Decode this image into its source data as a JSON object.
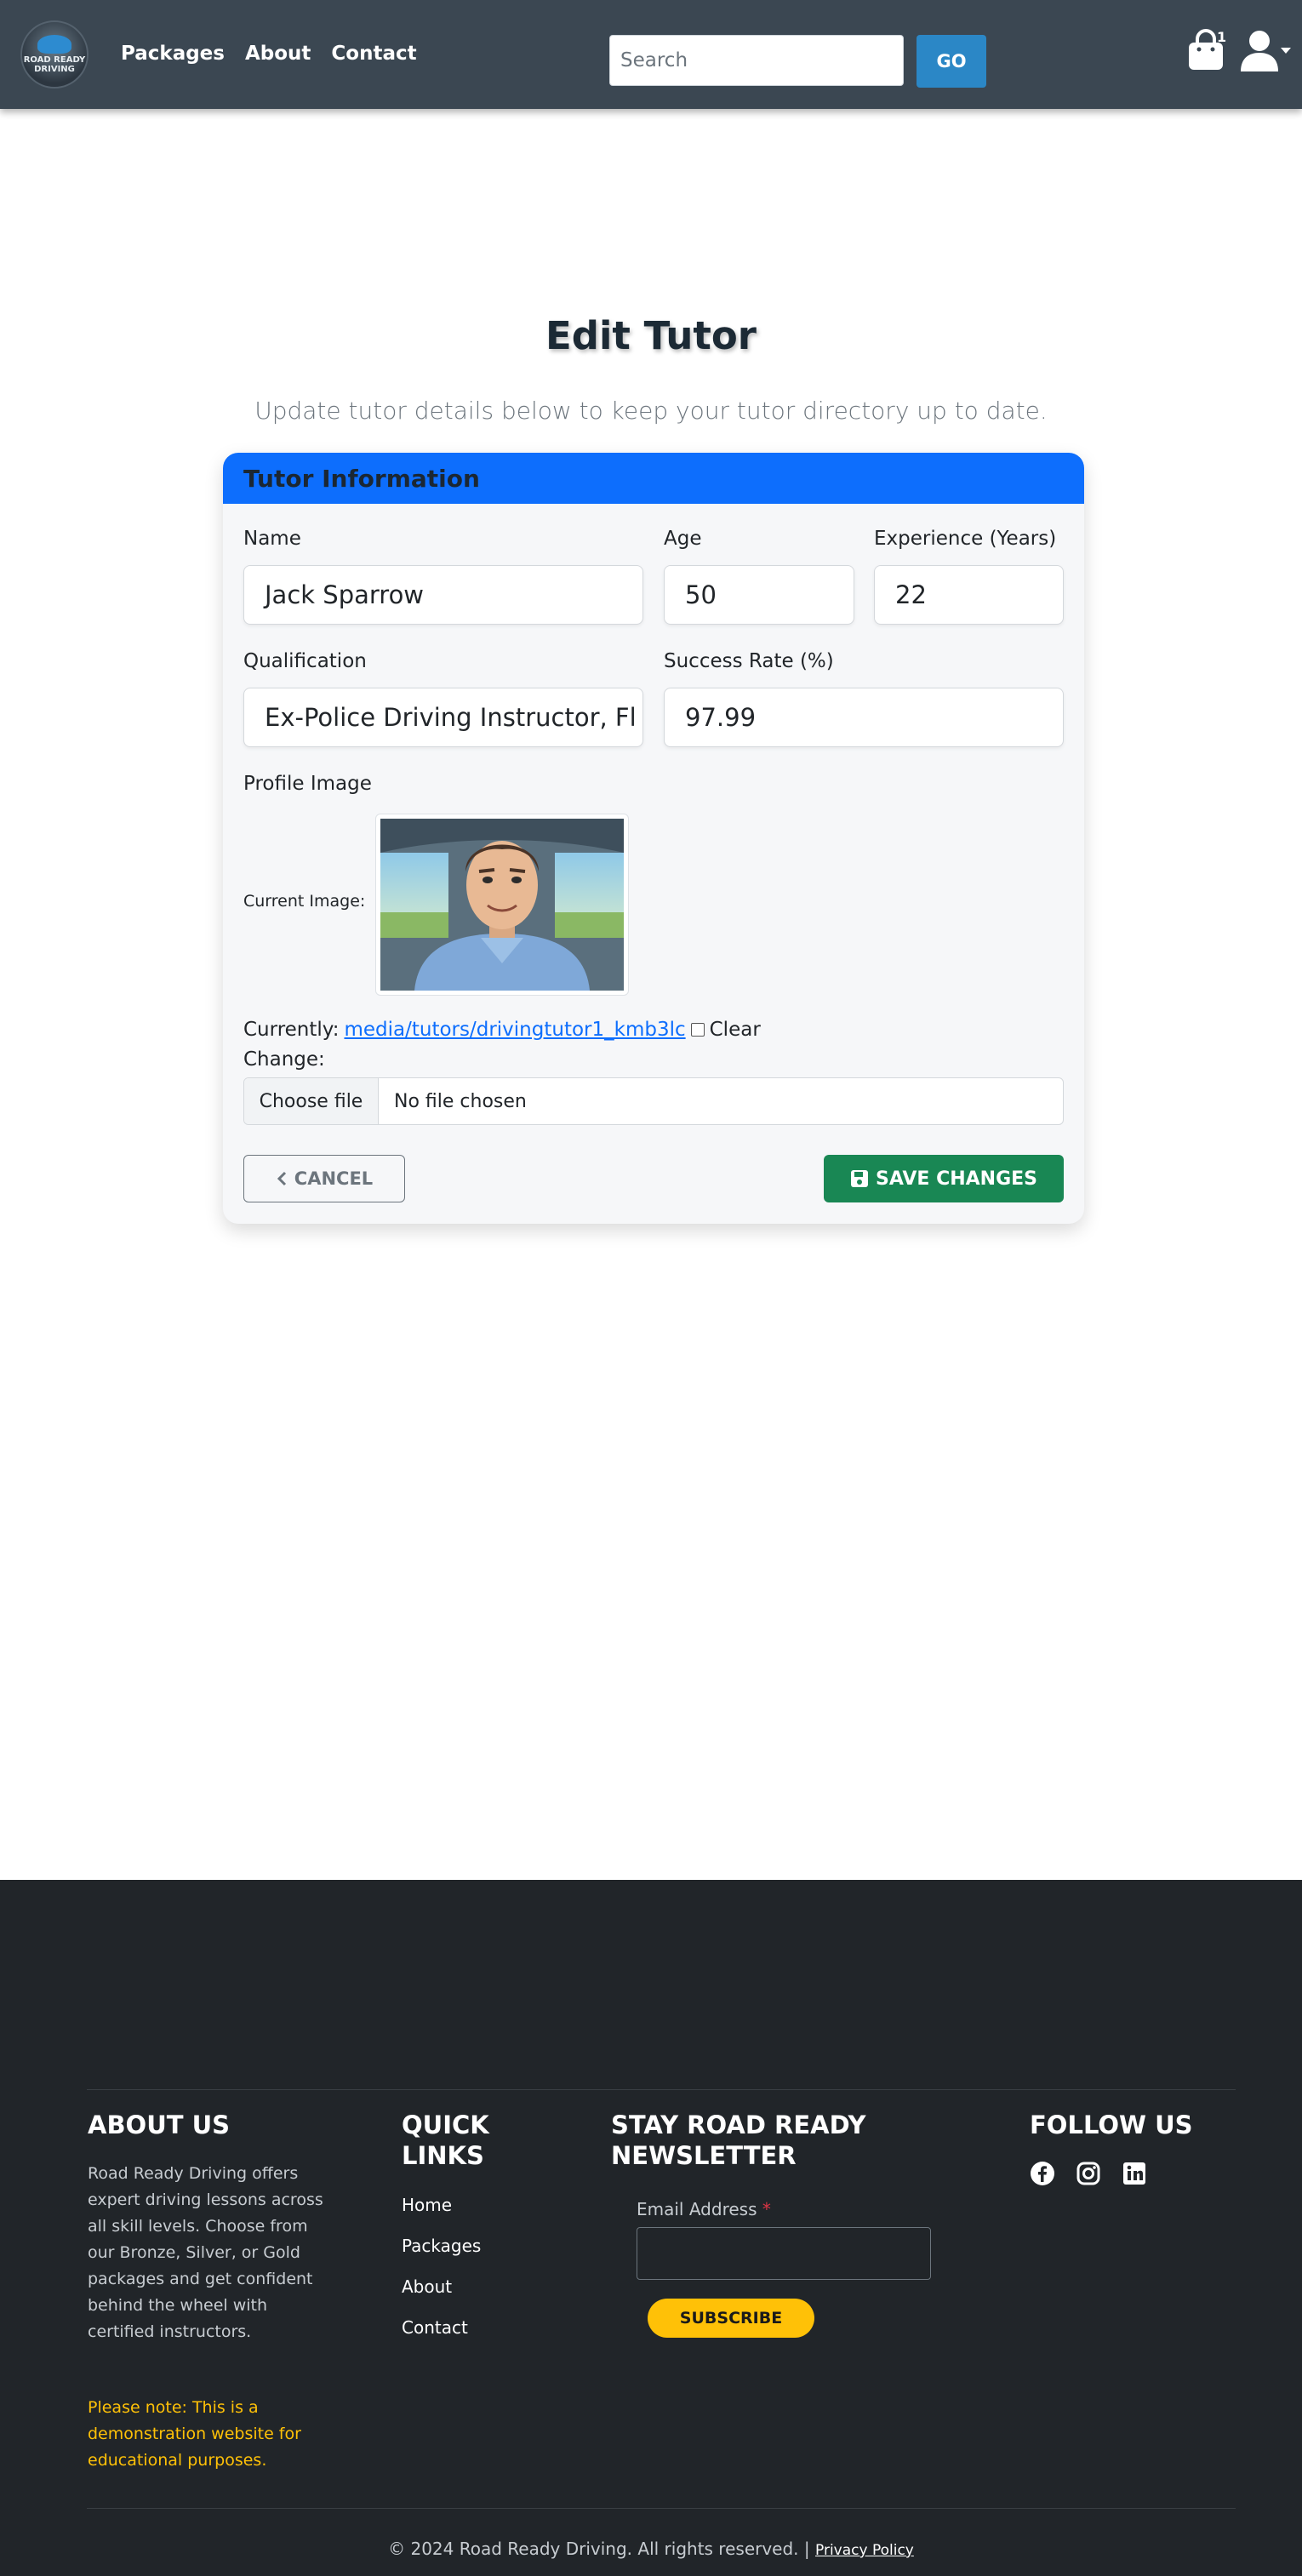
{
  "header": {
    "logo_text": "ROAD READY DRIVING",
    "nav": [
      "Packages",
      "About",
      "Contact"
    ],
    "search_placeholder": "Search",
    "go_label": "GO",
    "cart_count": "1"
  },
  "page": {
    "title": "Edit Tutor",
    "subtitle": "Update tutor details below to keep your tutor directory up to date."
  },
  "form": {
    "card_title": "Tutor Information",
    "name_label": "Name",
    "name_value": "Jack Sparrow",
    "age_label": "Age",
    "age_value": "50",
    "experience_label": "Experience (Years)",
    "experience_value": "22",
    "qualification_label": "Qualification",
    "qualification_value": "Ex-Police Driving Instructor, Fl",
    "success_label": "Success Rate (%)",
    "success_value": "97.99",
    "profile_image_label": "Profile Image",
    "current_image_label": "Current Image:",
    "currently_label": "Currently:",
    "current_file": "media/tutors/drivingtutor1_kmb3lc",
    "clear_label": "Clear",
    "change_label": "Change:",
    "choose_file_label": "Choose file",
    "file_status": "No file chosen",
    "cancel_label": "CANCEL",
    "save_label": "SAVE CHANGES"
  },
  "footer": {
    "about_heading": "ABOUT US",
    "about_text": "Road Ready Driving offers expert driving lessons across all skill levels. Choose from our Bronze, Silver, or Gold packages and get confident behind the wheel with certified instructors.",
    "note_text": "Please note: This is a demonstration website for educational purposes.",
    "quick_links_heading_1": "QUICK",
    "quick_links_heading_2": "LINKS",
    "quick_links": [
      "Home",
      "Packages",
      "About",
      "Contact"
    ],
    "newsletter_heading_1": "STAY ROAD READY",
    "newsletter_heading_2": "NEWSLETTER",
    "email_label": "Email Address",
    "required_mark": "*",
    "subscribe_label": "SUBSCRIBE",
    "follow_heading": "FOLLOW US",
    "social_icons": [
      "facebook-icon",
      "instagram-icon",
      "linkedin-icon"
    ],
    "copyright": "© 2024 Road Ready Driving. All rights reserved. |",
    "privacy_label": "Privacy Policy"
  },
  "colors": {
    "navbar_bg": "#3b4752",
    "primary": "#0d6efd",
    "go_button": "#2b87c6",
    "success": "#198754",
    "footer_bg": "#212529",
    "accent_yellow": "#ffc107"
  }
}
